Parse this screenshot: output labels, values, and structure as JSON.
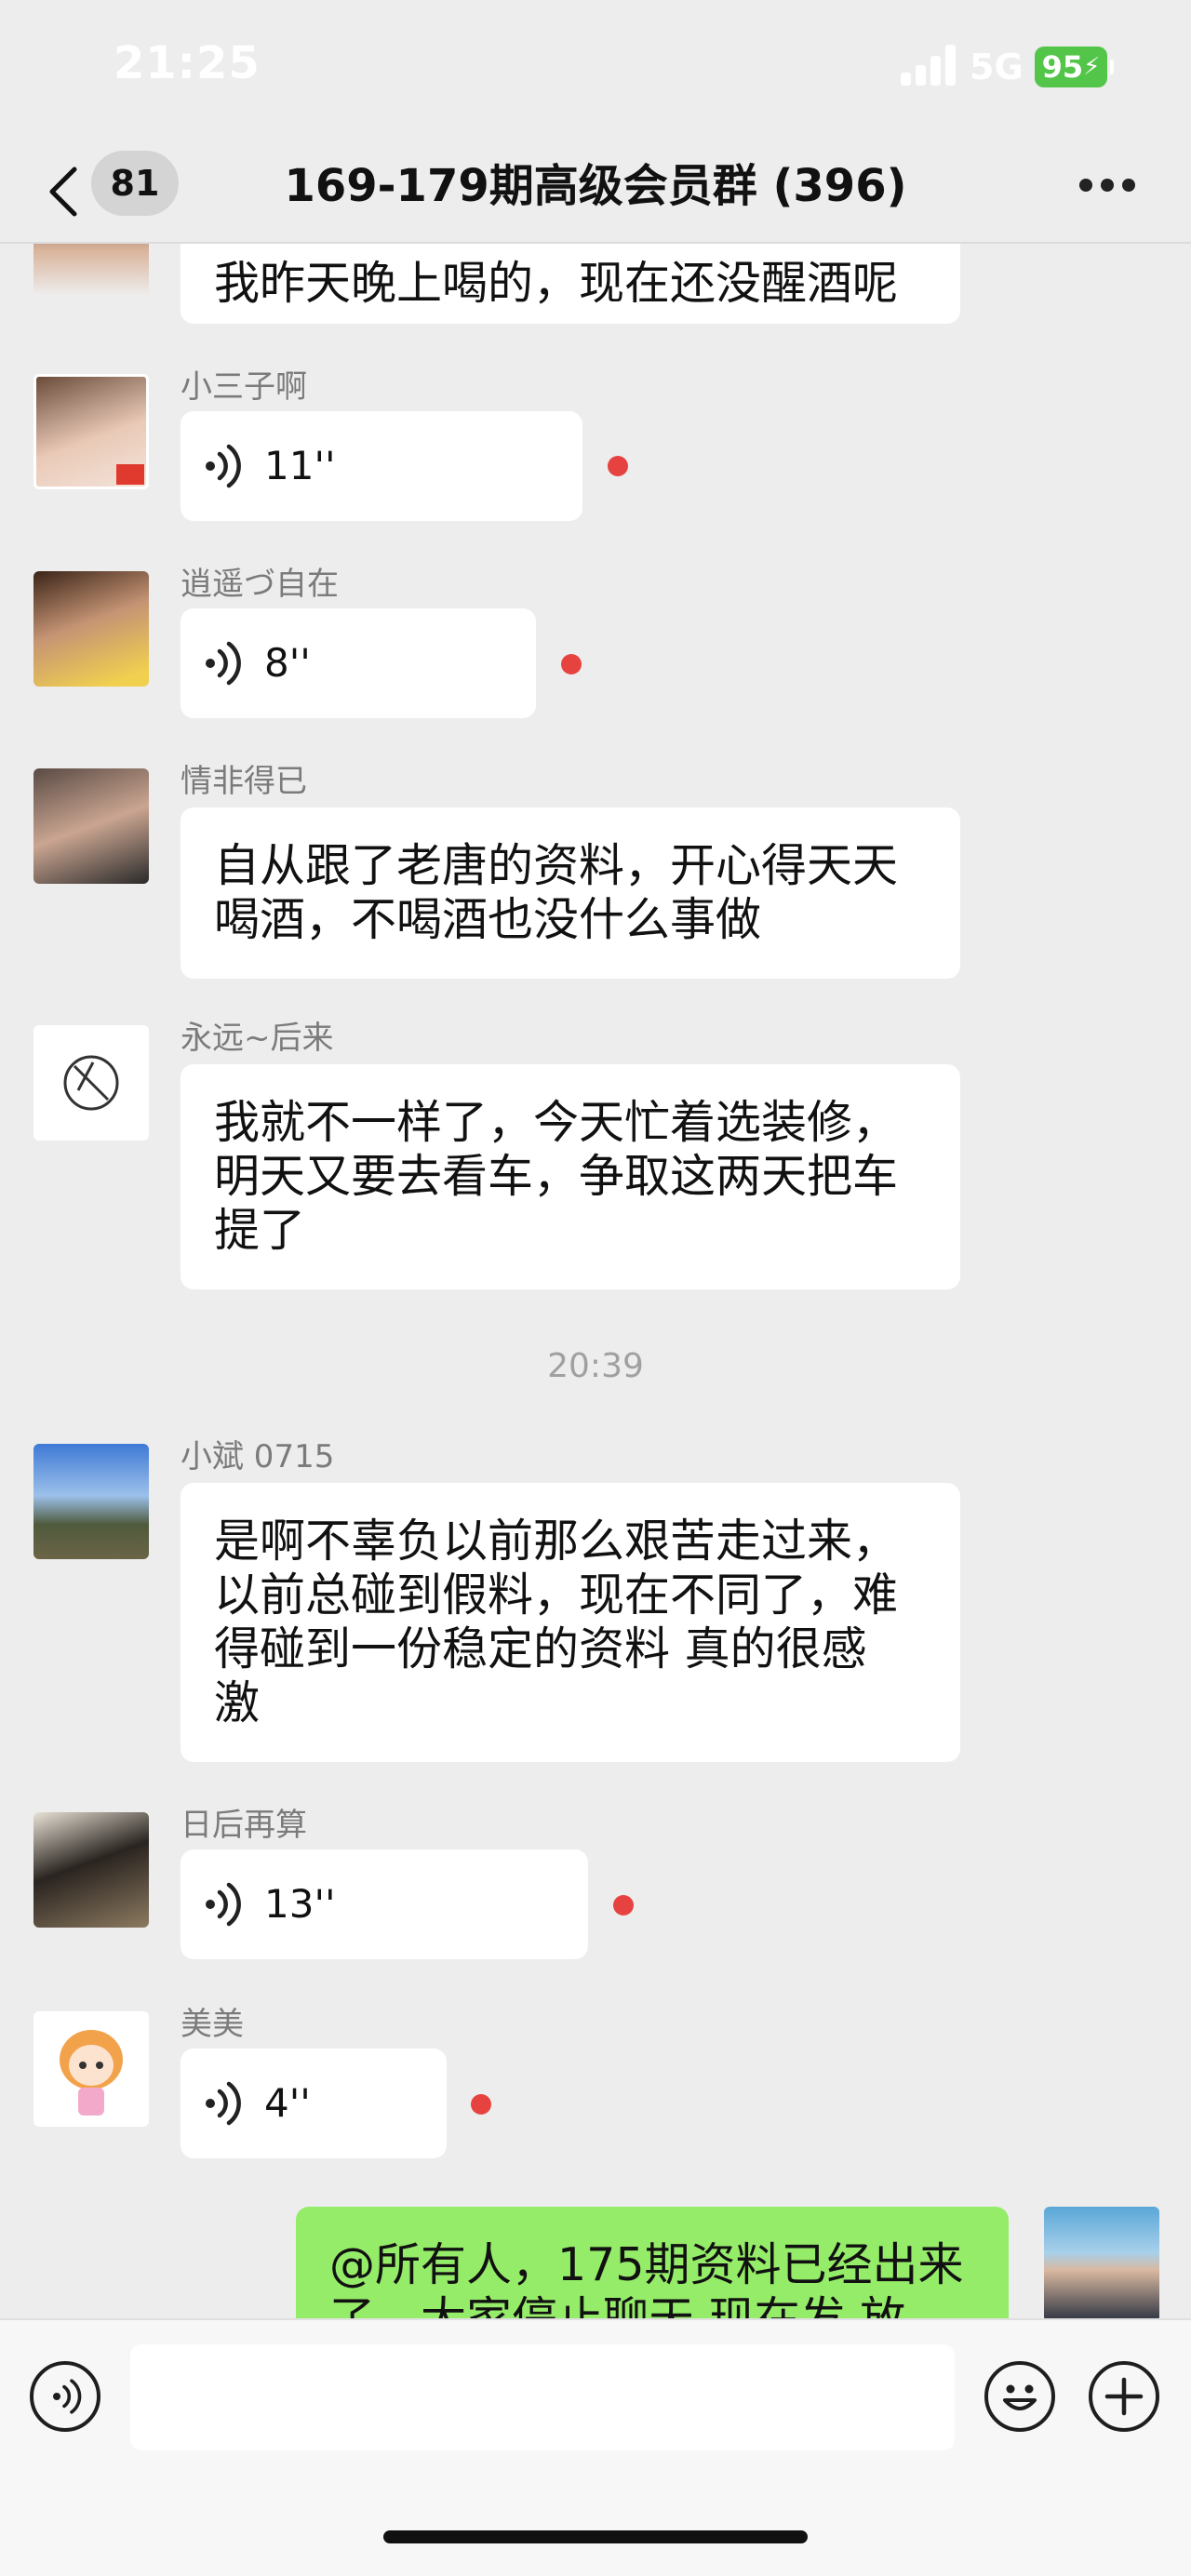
{
  "status_bar": {
    "time": "21:25",
    "network": "5G",
    "battery": "95"
  },
  "nav": {
    "unread_count": "81",
    "title": "169-179期高级会员群 (396)"
  },
  "messages": [
    {
      "text": "我昨天晚上喝的，现在还没醒酒呢"
    },
    {
      "sender": "小三子啊",
      "duration": "11''"
    },
    {
      "sender": "逍遥づ自在",
      "duration": "8''"
    },
    {
      "sender": "情非得已",
      "lines": [
        "自从跟了老唐的资料，开心得天天",
        "喝酒，不喝酒也没什么事做"
      ]
    },
    {
      "sender": "永远~后来",
      "lines": [
        "我就不一样了，今天忙着选装修，",
        "明天又要去看车，争取这两天把车",
        "提了"
      ]
    },
    {
      "sender": "小斌 0715",
      "lines": [
        "是啊不辜负以前那么艰苦走过来，",
        "以前总碰到假料，现在不同了，难",
        "得碰到一份稳定的资料 真的很感",
        "激"
      ]
    },
    {
      "sender": "日后再算",
      "duration": "13''"
    },
    {
      "sender": "美美",
      "duration": "4''"
    },
    {
      "lines": [
        "@所有人，175期资料已经出来",
        "了，大家停止聊天 现在发 放"
      ]
    }
  ],
  "timestamp": "20:39",
  "colors": {
    "background": "#EDEDED",
    "self_bubble": "#95EC69",
    "other_bubble": "#FFFFFF",
    "unread_dot": "#E64340",
    "battery": "#53C549"
  },
  "icons": [
    "back-icon",
    "more-icon",
    "voice-icon",
    "emoji-icon",
    "add-icon"
  ]
}
